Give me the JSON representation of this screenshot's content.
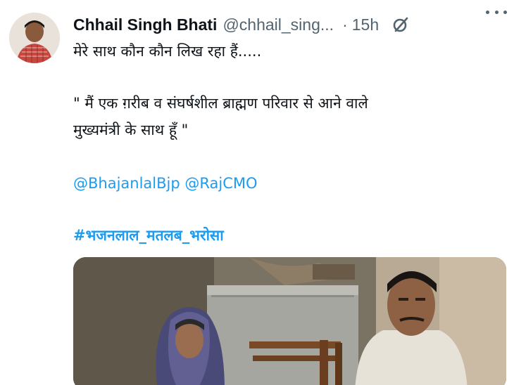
{
  "tweet": {
    "author_name": "Chhail Singh Bhati",
    "author_handle": "@chhail_sing...",
    "separator": "·",
    "timestamp": "15h",
    "line1": "मेरे साथ कौन कौन लिख रहा हैं.....",
    "quote_line1": "\" मैं एक ग़रीब व संघर्षशील ब्राह्मण परिवार से आने वाले",
    "quote_line2": "मुख्यमंत्री के साथ हूँ \"",
    "mention1": "@BhajanlalBjp",
    "mention2": "@RajCMO",
    "hashtag": "#भजनलाल_मतलब_भरोसा"
  },
  "icons": {
    "grok": "grok-icon",
    "more": "more-icon"
  },
  "colors": {
    "link": "#1d9bf0",
    "text": "#0f1419",
    "muted": "#536471"
  }
}
